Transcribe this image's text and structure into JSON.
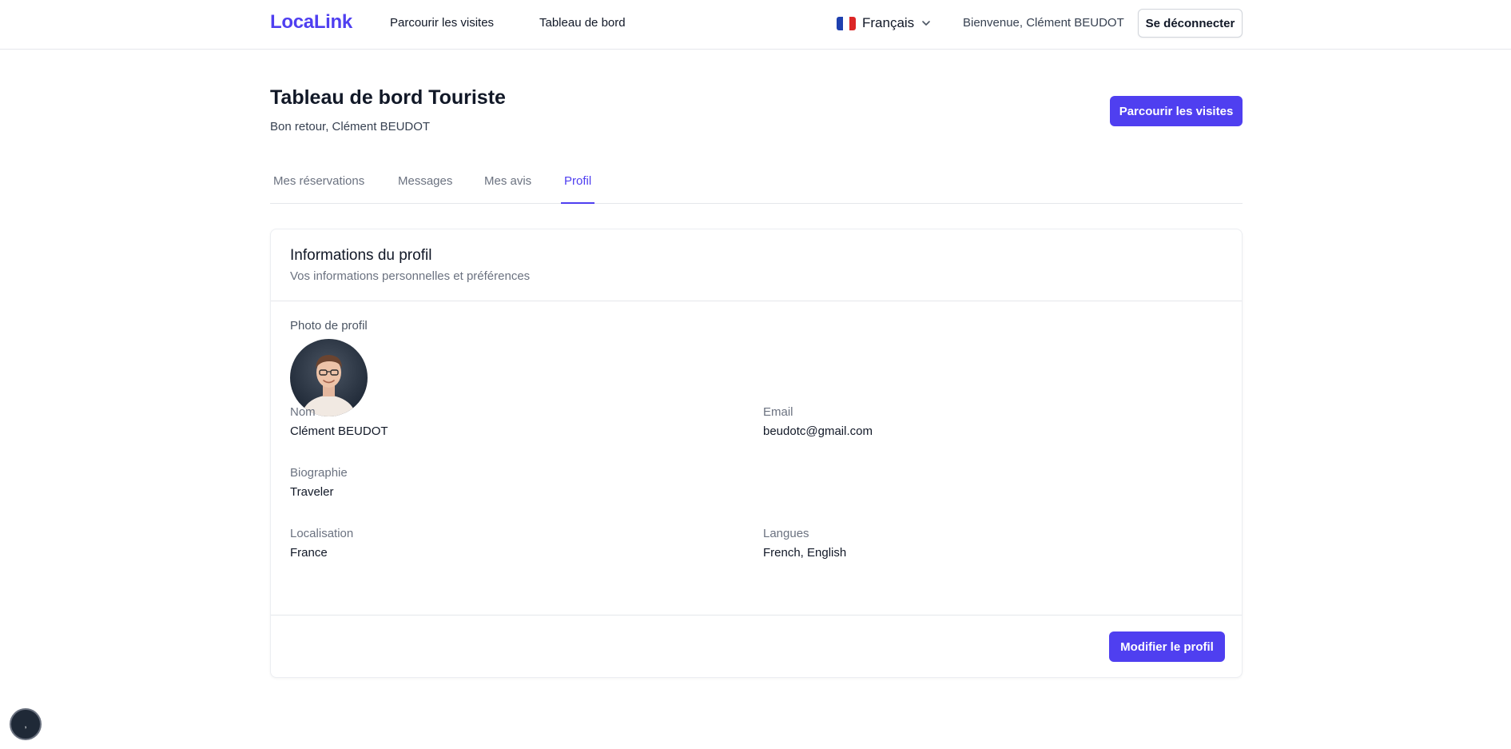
{
  "header": {
    "brand": "LocaLink",
    "nav": {
      "browse": "Parcourir les visites",
      "dashboard": "Tableau de bord"
    },
    "language": "Français",
    "welcome": "Bienvenue, Clément BEUDOT",
    "logout": "Se déconnecter"
  },
  "page": {
    "title": "Tableau de bord Touriste",
    "subtitle": "Bon retour, Clément BEUDOT",
    "browse_button": "Parcourir les visites"
  },
  "tabs": [
    {
      "label": "Mes réservations"
    },
    {
      "label": "Messages"
    },
    {
      "label": "Mes avis"
    },
    {
      "label": "Profil",
      "active": true
    }
  ],
  "profile": {
    "title": "Informations du profil",
    "description": "Vos informations personnelles et préférences",
    "photo_label": "Photo de profil",
    "name_label": "Nom",
    "name": "Clément BEUDOT",
    "email_label": "Email",
    "email": "beudotc@gmail.com",
    "bio_label": "Biographie",
    "bio": "Traveler",
    "location_label": "Localisation",
    "location": "France",
    "languages_label": "Langues",
    "languages": "French, English",
    "edit_button": "Modifier le profil"
  },
  "help": {
    "glyph": ","
  },
  "colors": {
    "accent": "#4f3ff0",
    "text": "#111827",
    "muted": "#6b7280",
    "border": "#e5e7eb"
  }
}
